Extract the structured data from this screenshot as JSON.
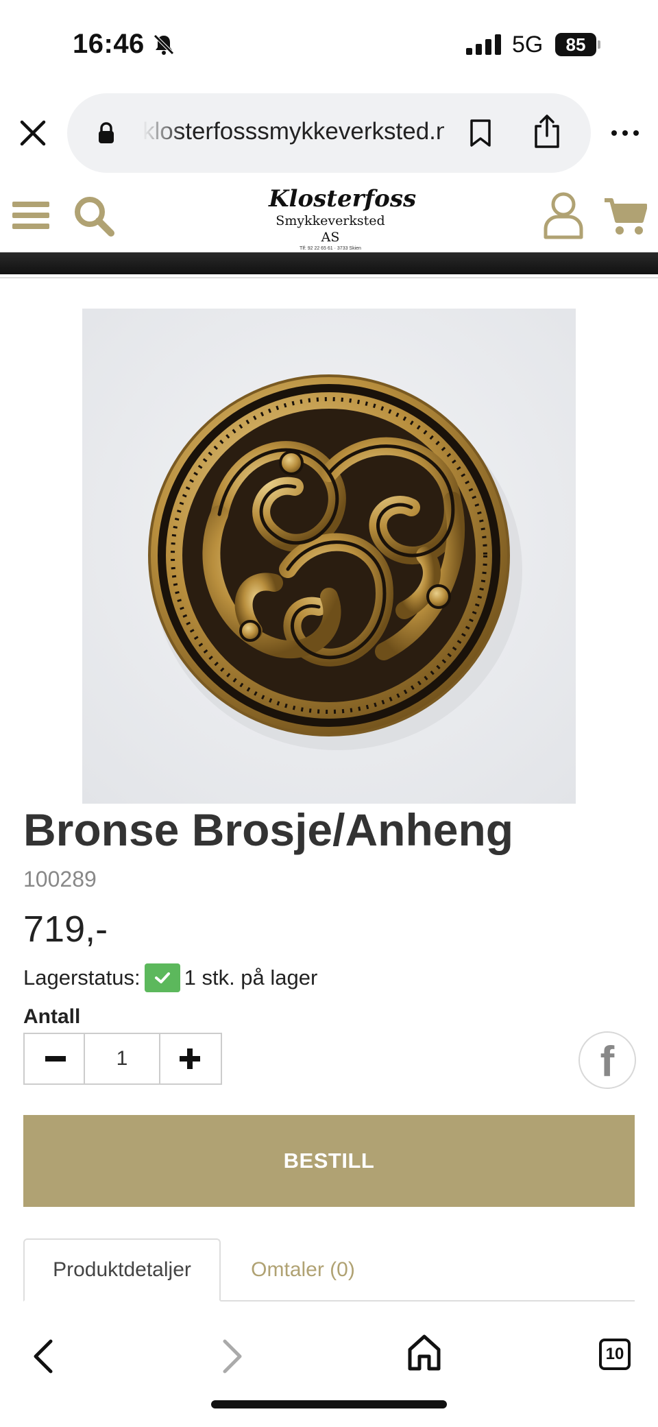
{
  "status_bar": {
    "time": "16:46",
    "network": "5G",
    "battery": "85"
  },
  "browser": {
    "url": "klosterfosssmykkeverksted.no"
  },
  "site": {
    "logo_main": "Klosterfoss",
    "logo_sub": "Smykkeverksted AS",
    "logo_small": "Tlf: 92 22 65 61 · 3733 Skien"
  },
  "product": {
    "title": "Bronse Brosje/Anheng",
    "sku": "100289",
    "price": "719,-",
    "stock_label": "Lagerstatus:",
    "stock_text": "1 stk. på lager",
    "quantity_label": "Antall",
    "quantity_value": "1",
    "order_button": "BESTILL"
  },
  "tabs": [
    {
      "label": "Produktdetaljer",
      "active": true
    },
    {
      "label": "Omtaler (0)",
      "active": false
    }
  ],
  "bottom_bar": {
    "tab_count": "10"
  },
  "colors": {
    "brand_gold": "#b0a273",
    "stock_green": "#5cb85c"
  }
}
